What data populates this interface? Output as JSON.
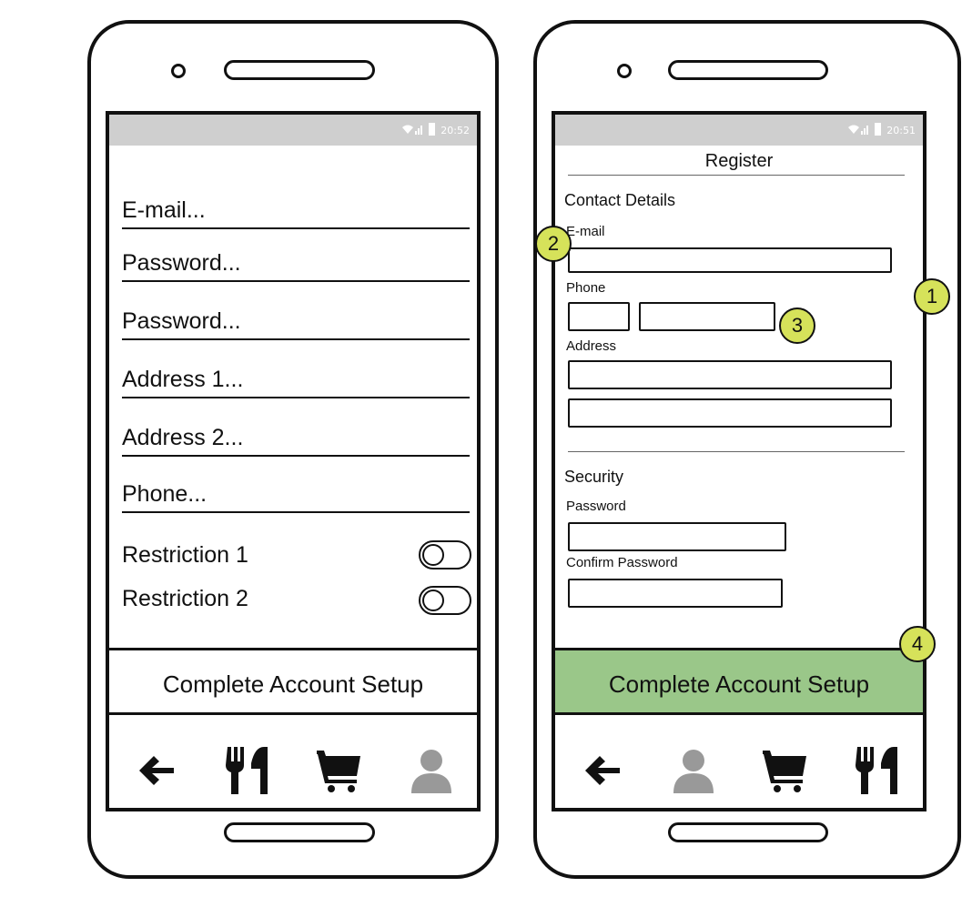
{
  "left_phone": {
    "status_time": "20:52",
    "fields": [
      "E-mail...",
      "Password...",
      "Password...",
      "Address 1...",
      "Address 2...",
      "Phone..."
    ],
    "restrictions": [
      "Restriction 1",
      "Restriction 2"
    ],
    "cta_label": "Complete Account Setup",
    "nav_icons": [
      "back-arrow-icon",
      "restaurant-icon",
      "cart-icon",
      "user-icon"
    ]
  },
  "right_phone": {
    "status_time": "20:51",
    "title": "Register",
    "contact_section": "Contact Details",
    "email_label": "E-mail",
    "phone_label": "Phone",
    "address_label": "Address",
    "security_section": "Security",
    "password_label": "Password",
    "confirm_password_label": "Confirm Password",
    "cta_label": "Complete Account Setup",
    "nav_icons": [
      "back-arrow-icon",
      "user-icon",
      "cart-icon",
      "restaurant-icon"
    ]
  },
  "callouts": [
    "1",
    "2",
    "3",
    "4"
  ],
  "colors": {
    "accent_green": "#9ac789",
    "callout_yellow": "#d6e25a",
    "status_bar": "#cfcfcf"
  }
}
